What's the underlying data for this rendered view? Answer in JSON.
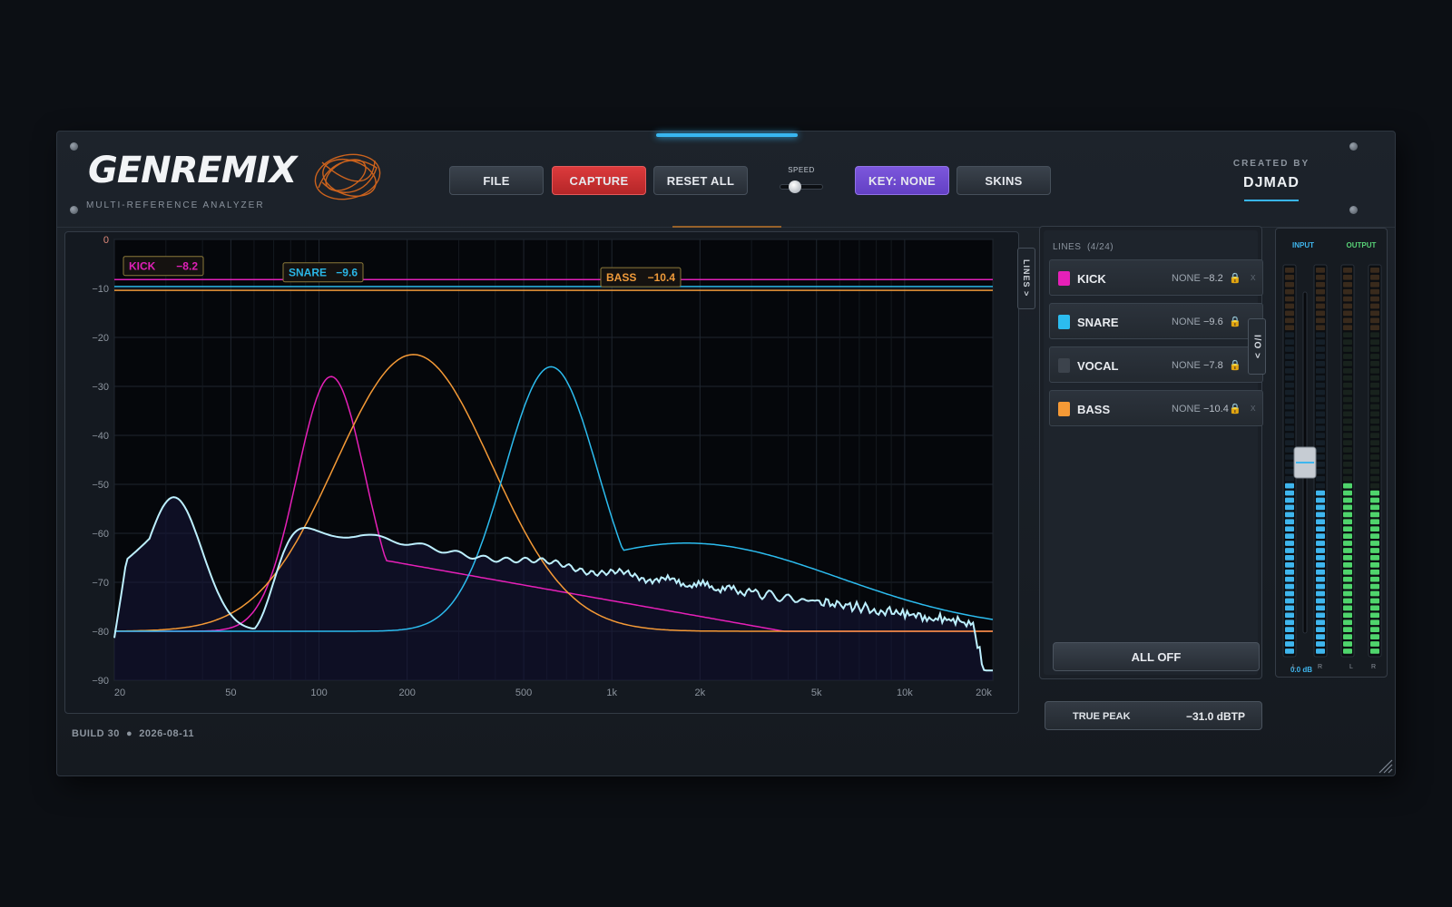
{
  "header": {
    "brand": "GENREMIX",
    "subtitle": "MULTI-REFERENCE ANALYZER",
    "buttons": {
      "file": "FILE",
      "capture": "CAPTURE",
      "reset_all": "RESET ALL",
      "key": "KEY: NONE",
      "skins": "SKINS"
    },
    "speed_label": "SPEED",
    "created_by_label": "CREATED BY",
    "created_by_name": "DJMAD"
  },
  "analyzer": {
    "y_ticks": [
      "0",
      "−10",
      "−20",
      "−30",
      "−40",
      "−50",
      "−60",
      "−70",
      "−80",
      "−90"
    ],
    "x_ticks": [
      "20",
      "50",
      "100",
      "200",
      "500",
      "1k",
      "2k",
      "5k",
      "10k",
      "20k"
    ],
    "side_tab": "LINES >",
    "tags": [
      {
        "name": "KICK",
        "value": "−8.2",
        "color": "#e020b8"
      },
      {
        "name": "SNARE",
        "value": "−9.6",
        "color": "#2ab6e6"
      },
      {
        "name": "BASS",
        "value": "−10.4",
        "color": "#ef9a3a"
      }
    ],
    "build": "BUILD 30",
    "date": "2026-08-11"
  },
  "lines_panel": {
    "header": "LINES",
    "count": "(4/24)",
    "rows": [
      {
        "name": "KICK",
        "key": "NONE",
        "value": "−8.2",
        "color": "#e620b8"
      },
      {
        "name": "SNARE",
        "key": "NONE",
        "value": "−9.6",
        "color": "#2cbcef"
      },
      {
        "name": "VOCAL",
        "key": "NONE",
        "value": "−7.8",
        "color": "#3c434c"
      },
      {
        "name": "BASS",
        "key": "NONE",
        "value": "−10.4",
        "color": "#f59a36"
      }
    ],
    "all_off": "ALL OFF",
    "io_tab": "I/O >"
  },
  "true_peak": {
    "label": "TRUE PEAK",
    "value": "−31.0 dBTP"
  },
  "meters": {
    "input_label": "INPUT",
    "output_label": "OUTPUT",
    "input_db": "0.0 dB",
    "channel_labels": [
      "L",
      "R",
      "L",
      "R"
    ],
    "levels": [
      0.45,
      0.43,
      0.44,
      0.42
    ],
    "fader_value": 0.5
  },
  "colors": {
    "kick": "#e620b8",
    "snare": "#2cbcef",
    "bass": "#f59a36",
    "mix": "#bdf0ff",
    "accent": "#38b6f0"
  }
}
